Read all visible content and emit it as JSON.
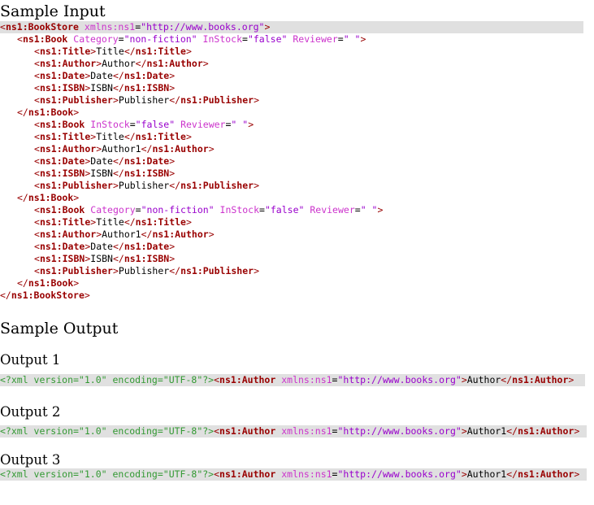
{
  "headings": {
    "sample_input": "Sample Input",
    "sample_output": "Sample Output",
    "output1": "Output 1",
    "output2": "Output 2",
    "output3": "Output 3"
  },
  "colors": {
    "tag": "#990000",
    "attr": "#cc33cc",
    "value": "#9900cc",
    "pi": "#339933",
    "highlight_bg": "#e0e0e0"
  },
  "input_lines": [
    {
      "indent": 0,
      "parts": [
        [
          "pun",
          "<"
        ],
        [
          "tag",
          "ns1:BookStore"
        ],
        [
          "txt",
          " "
        ],
        [
          "attr",
          "xmlns:ns1"
        ],
        [
          "txt",
          "="
        ],
        [
          "val",
          "\"http://www.books.org\""
        ],
        [
          "pun",
          ">"
        ]
      ],
      "hl": true
    },
    {
      "indent": 1,
      "parts": [
        [
          "pun",
          "<"
        ],
        [
          "tag",
          "ns1:Book"
        ],
        [
          "txt",
          " "
        ],
        [
          "attr",
          "Category"
        ],
        [
          "txt",
          "="
        ],
        [
          "val",
          "\"non-fiction\""
        ],
        [
          "txt",
          " "
        ],
        [
          "attr",
          "InStock"
        ],
        [
          "txt",
          "="
        ],
        [
          "val",
          "\"false\""
        ],
        [
          "txt",
          " "
        ],
        [
          "attr",
          "Reviewer"
        ],
        [
          "txt",
          "="
        ],
        [
          "val",
          "\" \""
        ],
        [
          "pun",
          ">"
        ]
      ]
    },
    {
      "indent": 2,
      "parts": [
        [
          "pun",
          "<"
        ],
        [
          "tag",
          "ns1:Title"
        ],
        [
          "pun",
          ">"
        ],
        [
          "txt",
          "Title"
        ],
        [
          "pun",
          "</"
        ],
        [
          "tag",
          "ns1:Title"
        ],
        [
          "pun",
          ">"
        ]
      ]
    },
    {
      "indent": 2,
      "parts": [
        [
          "pun",
          "<"
        ],
        [
          "tag",
          "ns1:Author"
        ],
        [
          "pun",
          ">"
        ],
        [
          "txt",
          "Author"
        ],
        [
          "pun",
          "</"
        ],
        [
          "tag",
          "ns1:Author"
        ],
        [
          "pun",
          ">"
        ]
      ]
    },
    {
      "indent": 2,
      "parts": [
        [
          "pun",
          "<"
        ],
        [
          "tag",
          "ns1:Date"
        ],
        [
          "pun",
          ">"
        ],
        [
          "txt",
          "Date"
        ],
        [
          "pun",
          "</"
        ],
        [
          "tag",
          "ns1:Date"
        ],
        [
          "pun",
          ">"
        ]
      ]
    },
    {
      "indent": 2,
      "parts": [
        [
          "pun",
          "<"
        ],
        [
          "tag",
          "ns1:ISBN"
        ],
        [
          "pun",
          ">"
        ],
        [
          "txt",
          "ISBN"
        ],
        [
          "pun",
          "</"
        ],
        [
          "tag",
          "ns1:ISBN"
        ],
        [
          "pun",
          ">"
        ]
      ]
    },
    {
      "indent": 2,
      "parts": [
        [
          "pun",
          "<"
        ],
        [
          "tag",
          "ns1:Publisher"
        ],
        [
          "pun",
          ">"
        ],
        [
          "txt",
          "Publisher"
        ],
        [
          "pun",
          "</"
        ],
        [
          "tag",
          "ns1:Publisher"
        ],
        [
          "pun",
          ">"
        ]
      ]
    },
    {
      "indent": 1,
      "parts": [
        [
          "pun",
          "</"
        ],
        [
          "tag",
          "ns1:Book"
        ],
        [
          "pun",
          ">"
        ]
      ]
    },
    {
      "indent": 2,
      "parts": [
        [
          "pun",
          "<"
        ],
        [
          "tag",
          "ns1:Book"
        ],
        [
          "txt",
          " "
        ],
        [
          "attr",
          "InStock"
        ],
        [
          "txt",
          "="
        ],
        [
          "val",
          "\"false\""
        ],
        [
          "txt",
          " "
        ],
        [
          "attr",
          "Reviewer"
        ],
        [
          "txt",
          "="
        ],
        [
          "val",
          "\" \""
        ],
        [
          "pun",
          ">"
        ]
      ]
    },
    {
      "indent": 2,
      "parts": [
        [
          "pun",
          "<"
        ],
        [
          "tag",
          "ns1:Title"
        ],
        [
          "pun",
          ">"
        ],
        [
          "txt",
          "Title"
        ],
        [
          "pun",
          "</"
        ],
        [
          "tag",
          "ns1:Title"
        ],
        [
          "pun",
          ">"
        ]
      ]
    },
    {
      "indent": 2,
      "parts": [
        [
          "pun",
          "<"
        ],
        [
          "tag",
          "ns1:Author"
        ],
        [
          "pun",
          ">"
        ],
        [
          "txt",
          "Author1"
        ],
        [
          "pun",
          "</"
        ],
        [
          "tag",
          "ns1:Author"
        ],
        [
          "pun",
          ">"
        ]
      ]
    },
    {
      "indent": 2,
      "parts": [
        [
          "pun",
          "<"
        ],
        [
          "tag",
          "ns1:Date"
        ],
        [
          "pun",
          ">"
        ],
        [
          "txt",
          "Date"
        ],
        [
          "pun",
          "</"
        ],
        [
          "tag",
          "ns1:Date"
        ],
        [
          "pun",
          ">"
        ]
      ]
    },
    {
      "indent": 2,
      "parts": [
        [
          "pun",
          "<"
        ],
        [
          "tag",
          "ns1:ISBN"
        ],
        [
          "pun",
          ">"
        ],
        [
          "txt",
          "ISBN"
        ],
        [
          "pun",
          "</"
        ],
        [
          "tag",
          "ns1:ISBN"
        ],
        [
          "pun",
          ">"
        ]
      ]
    },
    {
      "indent": 2,
      "parts": [
        [
          "pun",
          "<"
        ],
        [
          "tag",
          "ns1:Publisher"
        ],
        [
          "pun",
          ">"
        ],
        [
          "txt",
          "Publisher"
        ],
        [
          "pun",
          "</"
        ],
        [
          "tag",
          "ns1:Publisher"
        ],
        [
          "pun",
          ">"
        ]
      ]
    },
    {
      "indent": 1,
      "parts": [
        [
          "pun",
          "</"
        ],
        [
          "tag",
          "ns1:Book"
        ],
        [
          "pun",
          ">"
        ]
      ]
    },
    {
      "indent": 2,
      "parts": [
        [
          "pun",
          "<"
        ],
        [
          "tag",
          "ns1:Book"
        ],
        [
          "txt",
          " "
        ],
        [
          "attr",
          "Category"
        ],
        [
          "txt",
          "="
        ],
        [
          "val",
          "\"non-fiction\""
        ],
        [
          "txt",
          " "
        ],
        [
          "attr",
          "InStock"
        ],
        [
          "txt",
          "="
        ],
        [
          "val",
          "\"false\""
        ],
        [
          "txt",
          " "
        ],
        [
          "attr",
          "Reviewer"
        ],
        [
          "txt",
          "="
        ],
        [
          "val",
          "\" \""
        ],
        [
          "pun",
          ">"
        ]
      ]
    },
    {
      "indent": 2,
      "parts": [
        [
          "pun",
          "<"
        ],
        [
          "tag",
          "ns1:Title"
        ],
        [
          "pun",
          ">"
        ],
        [
          "txt",
          "Title"
        ],
        [
          "pun",
          "</"
        ],
        [
          "tag",
          "ns1:Title"
        ],
        [
          "pun",
          ">"
        ]
      ]
    },
    {
      "indent": 2,
      "parts": [
        [
          "pun",
          "<"
        ],
        [
          "tag",
          "ns1:Author"
        ],
        [
          "pun",
          ">"
        ],
        [
          "txt",
          "Author1"
        ],
        [
          "pun",
          "</"
        ],
        [
          "tag",
          "ns1:Author"
        ],
        [
          "pun",
          ">"
        ]
      ]
    },
    {
      "indent": 2,
      "parts": [
        [
          "pun",
          "<"
        ],
        [
          "tag",
          "ns1:Date"
        ],
        [
          "pun",
          ">"
        ],
        [
          "txt",
          "Date"
        ],
        [
          "pun",
          "</"
        ],
        [
          "tag",
          "ns1:Date"
        ],
        [
          "pun",
          ">"
        ]
      ]
    },
    {
      "indent": 2,
      "parts": [
        [
          "pun",
          "<"
        ],
        [
          "tag",
          "ns1:ISBN"
        ],
        [
          "pun",
          ">"
        ],
        [
          "txt",
          "ISBN"
        ],
        [
          "pun",
          "</"
        ],
        [
          "tag",
          "ns1:ISBN"
        ],
        [
          "pun",
          ">"
        ]
      ]
    },
    {
      "indent": 2,
      "parts": [
        [
          "pun",
          "<"
        ],
        [
          "tag",
          "ns1:Publisher"
        ],
        [
          "pun",
          ">"
        ],
        [
          "txt",
          "Publisher"
        ],
        [
          "pun",
          "</"
        ],
        [
          "tag",
          "ns1:Publisher"
        ],
        [
          "pun",
          ">"
        ]
      ]
    },
    {
      "indent": 1,
      "parts": [
        [
          "pun",
          "</"
        ],
        [
          "tag",
          "ns1:Book"
        ],
        [
          "pun",
          ">"
        ]
      ]
    },
    {
      "indent": 0,
      "parts": [
        [
          "pun",
          "</"
        ],
        [
          "tag",
          "ns1:BookStore"
        ],
        [
          "pun",
          ">"
        ]
      ]
    }
  ],
  "outputs": [
    {
      "parts": [
        [
          "pi",
          "<?xml version=\"1.0\" encoding=\"UTF-8\"?>"
        ],
        [
          "pun",
          "<"
        ],
        [
          "tag",
          "ns1:Author"
        ],
        [
          "txt",
          " "
        ],
        [
          "attr",
          "xmlns:ns1"
        ],
        [
          "txt",
          "="
        ],
        [
          "val",
          "\"http://www.books.org\""
        ],
        [
          "pun",
          ">"
        ],
        [
          "txt",
          "Author"
        ],
        [
          "pun",
          "</"
        ],
        [
          "tag",
          "ns1:Author"
        ],
        [
          "pun",
          ">"
        ],
        [
          "txt",
          " "
        ]
      ]
    },
    {
      "parts": [
        [
          "pi",
          "<?xml version=\"1.0\" encoding=\"UTF-8\"?>"
        ],
        [
          "pun",
          "<"
        ],
        [
          "tag",
          "ns1:Author"
        ],
        [
          "txt",
          " "
        ],
        [
          "attr",
          "xmlns:ns1"
        ],
        [
          "txt",
          "="
        ],
        [
          "val",
          "\"http://www.books.org\""
        ],
        [
          "pun",
          ">"
        ],
        [
          "txt",
          "Author1"
        ],
        [
          "pun",
          "</"
        ],
        [
          "tag",
          "ns1:Author"
        ],
        [
          "pun",
          ">"
        ]
      ]
    },
    {
      "parts": [
        [
          "pi",
          "<?xml version=\"1.0\" encoding=\"UTF-8\"?>"
        ],
        [
          "pun",
          "<"
        ],
        [
          "tag",
          "ns1:Author"
        ],
        [
          "txt",
          " "
        ],
        [
          "attr",
          "xmlns:ns1"
        ],
        [
          "txt",
          "="
        ],
        [
          "val",
          "\"http://www.books.org\""
        ],
        [
          "pun",
          ">"
        ],
        [
          "txt",
          "Author1"
        ],
        [
          "pun",
          "</"
        ],
        [
          "tag",
          "ns1:Author"
        ],
        [
          "pun",
          ">"
        ]
      ]
    }
  ]
}
